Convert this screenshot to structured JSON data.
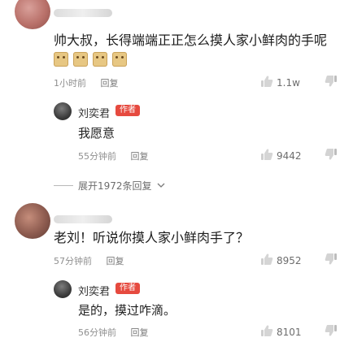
{
  "comments": [
    {
      "text": "帅大叔，长得端端正正怎么摸人家小鲜肉的手呢",
      "time": "1小时前",
      "reply": "回复",
      "likes": "1.1w",
      "emoji_icon": "grinning-cat-emoji",
      "reply_item": {
        "name": "刘奕君",
        "tag": "作者",
        "text": "我愿意",
        "time": "55分钟前",
        "reply": "回复",
        "likes": "9442"
      },
      "expand": "展开1972条回复"
    },
    {
      "text": "老刘！听说你摸人家小鲜肉手了？",
      "time": "57分钟前",
      "reply": "回复",
      "likes": "8952",
      "reply_item": {
        "name": "刘奕君",
        "tag": "作者",
        "text": "是的，摸过咋滴。",
        "time": "56分钟前",
        "reply": "回复",
        "likes": "8101"
      }
    }
  ],
  "icons": {
    "like": "thumbs-up-icon",
    "dislike": "thumbs-down-icon",
    "expand": "chevron-down-icon"
  },
  "colors": {
    "author_tag": "#e64a3f",
    "meta_text": "#8f8f8f"
  }
}
